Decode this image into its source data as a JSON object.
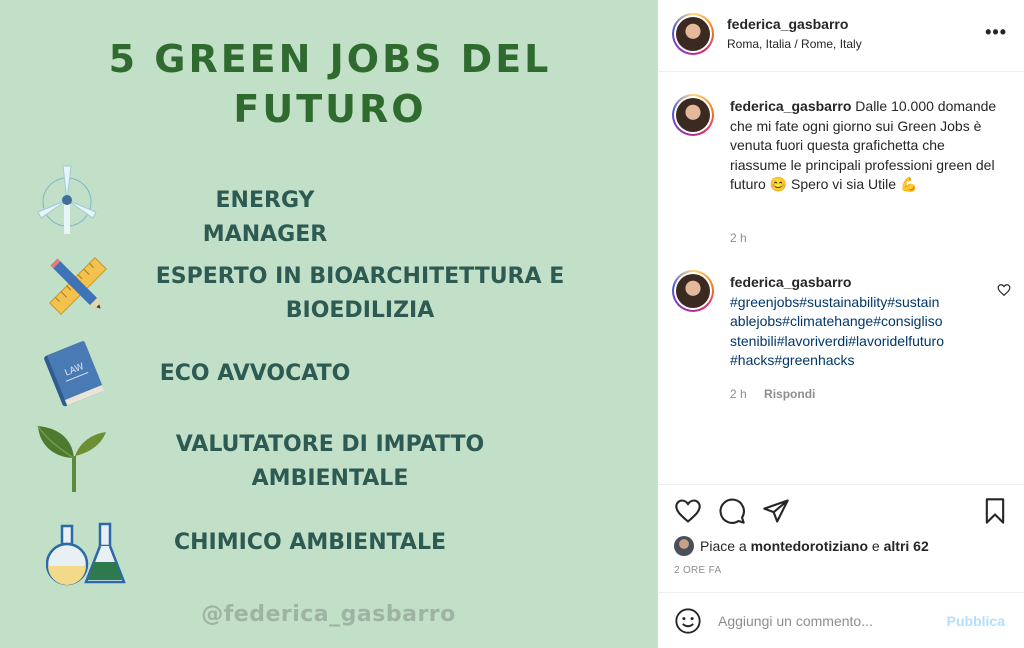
{
  "post": {
    "title": "5 Green Jobs del Futuro",
    "jobs": [
      {
        "label_lines": [
          "ENERGY MANAGER"
        ],
        "icon": "wind-turbine-icon"
      },
      {
        "label_lines": [
          "ESPERTO IN BIOARCHITETTURA E",
          "BIOEDILIZIA"
        ],
        "icon": "ruler-pencil-icon"
      },
      {
        "label_lines": [
          "ECO AVVOCATO"
        ],
        "icon": "law-book-icon"
      },
      {
        "label_lines": [
          "VALUTATORE DI IMPATTO",
          "AMBIENTALE"
        ],
        "icon": "sprout-icon"
      },
      {
        "label_lines": [
          "CHIMICO AMBIENTALE"
        ],
        "icon": "flasks-icon"
      }
    ],
    "watermark": "@federica_gasbarro",
    "law_book_text": "LAW"
  },
  "header": {
    "username": "federica_gasbarro",
    "location": "Roma, Italia / Rome, Italy",
    "more": "•••"
  },
  "caption": {
    "username": "federica_gasbarro",
    "text": "Dalle 10.000 domande che mi fate ogni giorno sui Green Jobs è venuta fuori questa grafichetta che riassume le principali professioni green del futuro 😊 Spero vi sia Utile 💪",
    "time": "2 h"
  },
  "comment": {
    "username": "federica_gasbarro",
    "hashtags_lines": [
      "#greenjobs#sustainability#sustain",
      "ablejobs#climatehange#consigliso",
      "stenibili#lavoriverdi#lavoridelfuturo",
      "#hacks#greenhacks"
    ],
    "time": "2 h",
    "reply": "Rispondi"
  },
  "likes": {
    "prefix": "Piace a",
    "user": "montedorotiziano",
    "conj": "e",
    "others": "altri 62"
  },
  "timeago": "2 ORE FA",
  "add_comment": {
    "placeholder": "Aggiungi un commento...",
    "publish": "Pubblica"
  },
  "colors": {
    "image_bg": "#c2dfc8",
    "title": "#2f6a2f",
    "job_label": "#2d5a52",
    "hashtag": "#00376b",
    "publish_disabled": "#b2dffc"
  }
}
